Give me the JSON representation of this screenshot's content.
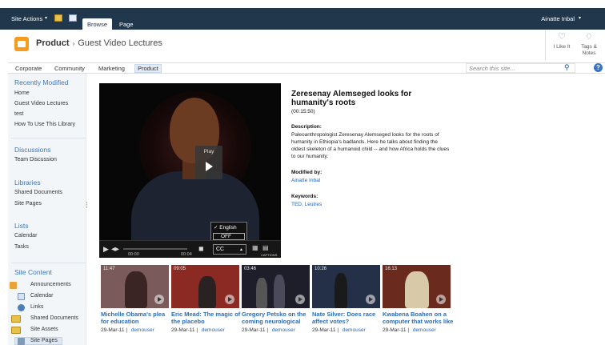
{
  "ribbon": {
    "site_actions": "Site Actions",
    "caret": "▾",
    "tabs": [
      {
        "label": "Browse"
      },
      {
        "label": "Page"
      }
    ],
    "user": "Ainatte Inbal"
  },
  "header": {
    "site": "Product",
    "separator": "›",
    "page": "Guest Video Lectures",
    "like_label": "I Like It",
    "tags_label_1": "Tags &",
    "tags_label_2": "Notes"
  },
  "topnav": {
    "items": [
      {
        "label": "Corporate"
      },
      {
        "label": "Community"
      },
      {
        "label": "Marketing"
      },
      {
        "label": "Product"
      }
    ],
    "selected": "Product",
    "search_placeholder": "Search this site...",
    "help": "?"
  },
  "leftnav": {
    "recently_modified": {
      "heading": "Recently Modified",
      "items": [
        "Home",
        "Guest Video Lectures",
        "test",
        "How To Use This Library"
      ]
    },
    "discussions": {
      "heading": "Discussions",
      "items": [
        "Team Discussion"
      ]
    },
    "libraries": {
      "heading": "Libraries",
      "items": [
        "Shared Documents",
        "Site Pages"
      ]
    },
    "lists": {
      "heading": "Lists",
      "items": [
        "Calendar",
        "Tasks"
      ]
    },
    "site_content": {
      "heading": "Site Content",
      "items": [
        "Announcements",
        "Calendar",
        "Links",
        "Shared Documents",
        "Site Assets",
        "Site Pages"
      ]
    }
  },
  "player": {
    "play_label": "Play",
    "cc_options": [
      "English",
      "OFF"
    ],
    "cc_check": "✓",
    "time_current": "00:00",
    "time_total": "00:04",
    "cc_label": "CC",
    "captions_label": "CAPTIONS"
  },
  "video": {
    "title": "Zeresenay Alemseged looks for humanity's roots",
    "duration": "(00:15:50)",
    "description_label": "Description:",
    "description": "Paleoanthropologist Zeresenay Alemseged looks for the roots of humanity in Ethiopia's badlands. Here he talks about finding the oldest skeleton of a humanoid child -- and how Africa holds the clues to our humanity.",
    "modified_label": "Modified by:",
    "modified_by": "Ainatte Inbal",
    "keywords_label": "Keywords:",
    "keywords": "TED, Leutres"
  },
  "thumbnails": [
    {
      "duration": "11:47",
      "title": "Michelle Obama's plea for education",
      "date": "29-Mar-11",
      "user": "demouser",
      "bg": "#7a5a5a"
    },
    {
      "duration": "09:05",
      "title": "Eric Mead: The magic of the placebo",
      "date": "29-Mar-11",
      "user": "demouser",
      "bg": "#8a2a22"
    },
    {
      "duration": "03:46",
      "title": "Gregory Petsko on the coming neurological",
      "date": "29-Mar-11",
      "user": "demouser",
      "bg": "#1e1e2a"
    },
    {
      "duration": "10:26",
      "title": "Nate Silver: Does race affect votes?",
      "date": "29-Mar-11",
      "user": "demouser",
      "bg": "#243048"
    },
    {
      "duration": "16:13",
      "title": "Kwabena Boahen on a computer that works like",
      "date": "29-Mar-11",
      "user": "demouser",
      "bg": "#6a2a1e"
    }
  ]
}
